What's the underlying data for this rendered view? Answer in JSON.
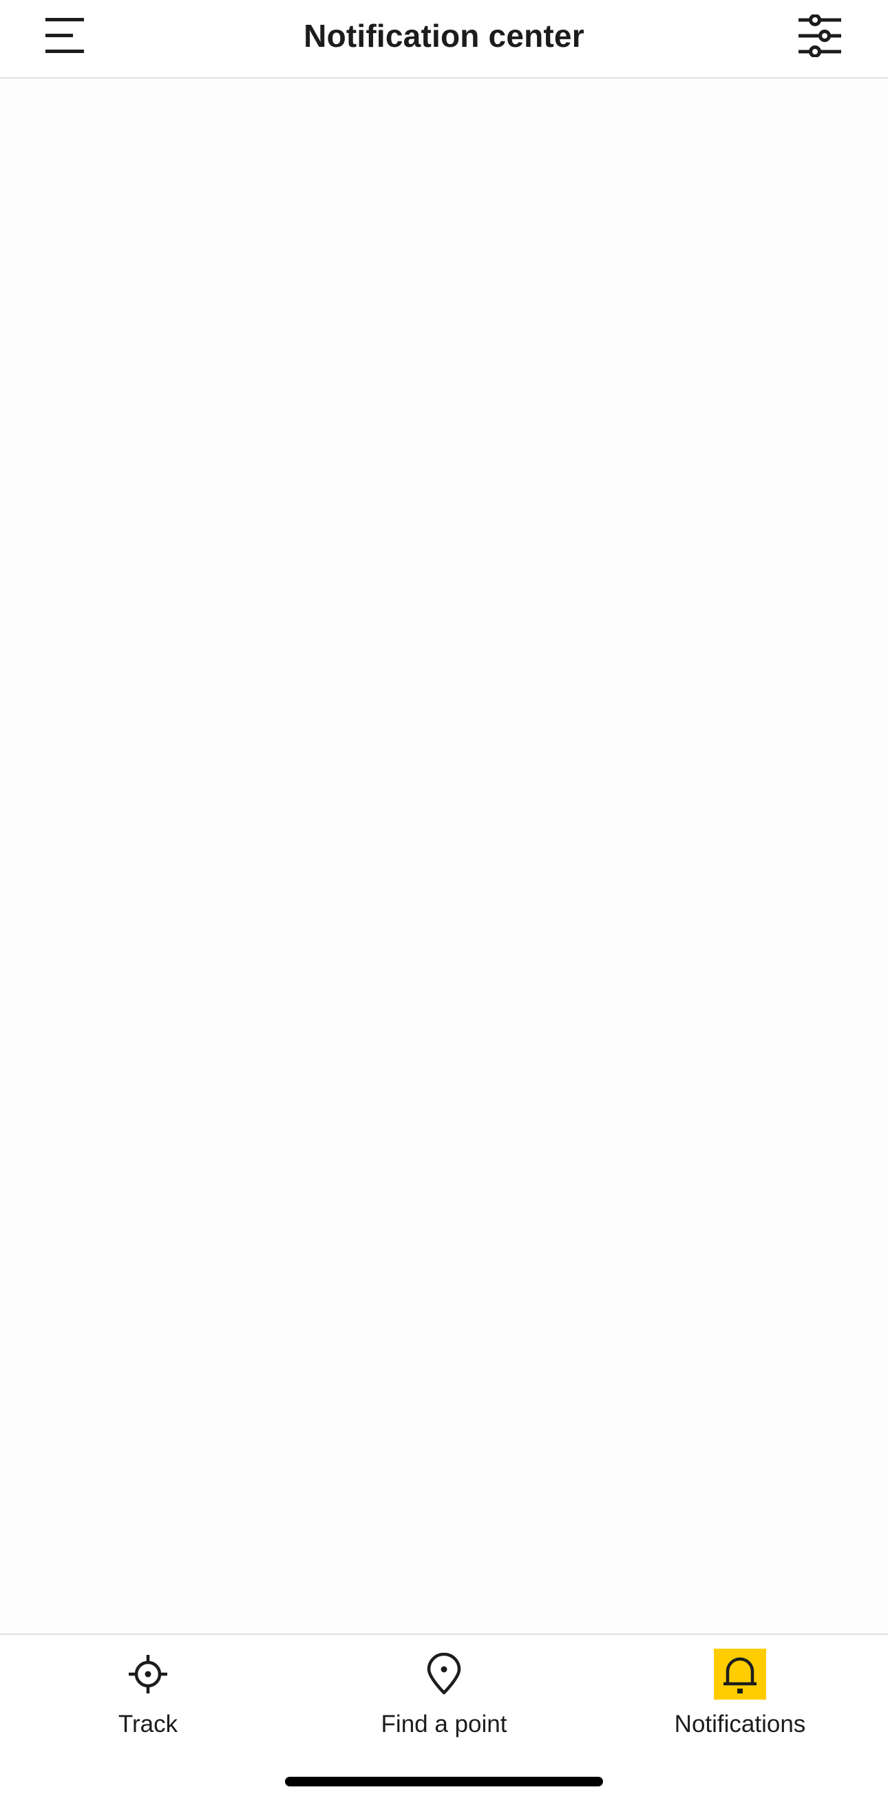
{
  "header": {
    "title": "Notification center",
    "menu_icon": "menu-icon",
    "filter_icon": "sliders-icon"
  },
  "content": {
    "items": []
  },
  "bottom_nav": {
    "active_color": "#ffcc00",
    "items": [
      {
        "label": "Track",
        "icon": "crosshair-icon",
        "active": false
      },
      {
        "label": "Find a point",
        "icon": "map-pin-icon",
        "active": false
      },
      {
        "label": "Notifications",
        "icon": "bell-icon",
        "active": true
      }
    ]
  }
}
